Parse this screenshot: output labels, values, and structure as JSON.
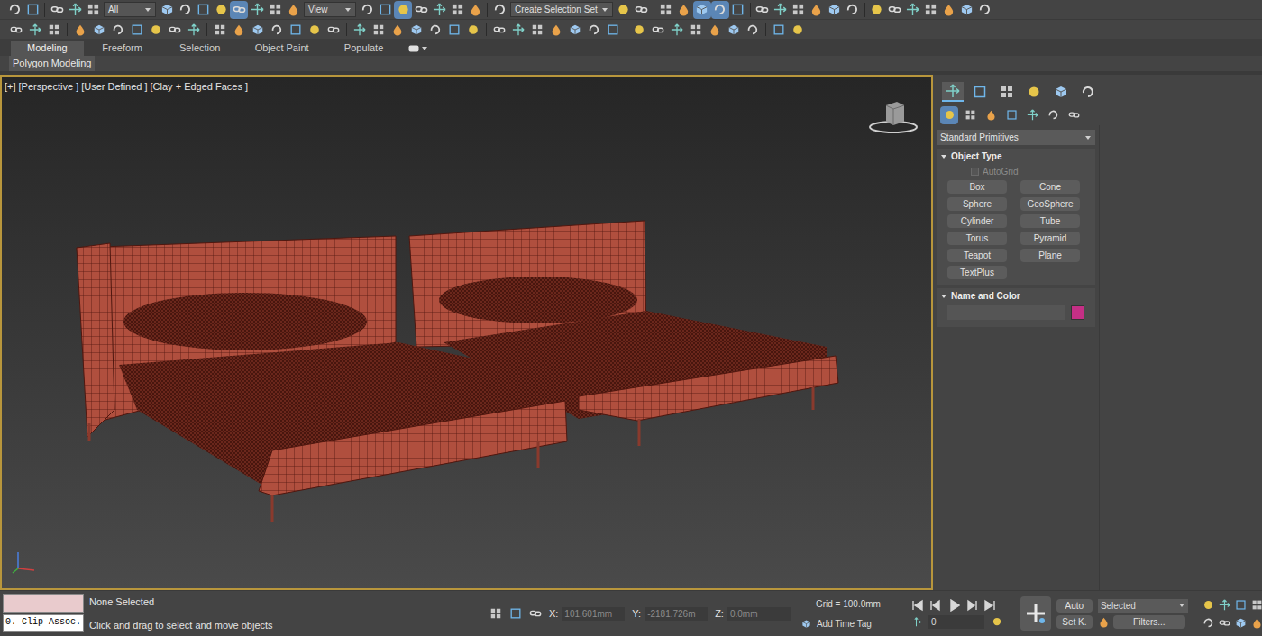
{
  "main_toolbar": {
    "items": [
      {
        "kind": "icon",
        "selected": false
      },
      {
        "kind": "icon",
        "selected": false
      },
      {
        "kind": "separator"
      },
      {
        "kind": "icon",
        "selected": false
      },
      {
        "kind": "icon",
        "selected": false
      },
      {
        "kind": "icon",
        "selected": false
      },
      {
        "kind": "dropdown",
        "text": "All"
      },
      {
        "kind": "icon",
        "selected": false
      },
      {
        "kind": "icon",
        "selected": false
      },
      {
        "kind": "icon",
        "selected": false
      },
      {
        "kind": "icon",
        "selected": false
      },
      {
        "kind": "icon",
        "selected": true
      },
      {
        "kind": "icon",
        "selected": false
      },
      {
        "kind": "icon",
        "selected": false
      },
      {
        "kind": "icon",
        "selected": false
      },
      {
        "kind": "dropdown",
        "text": "View"
      },
      {
        "kind": "icon",
        "selected": false
      },
      {
        "kind": "icon",
        "selected": false
      },
      {
        "kind": "icon",
        "selected": true
      },
      {
        "kind": "icon",
        "selected": false
      },
      {
        "kind": "icon",
        "selected": false
      },
      {
        "kind": "icon",
        "selected": false
      },
      {
        "kind": "icon",
        "selected": false
      },
      {
        "kind": "separator"
      },
      {
        "kind": "icon",
        "selected": false
      },
      {
        "kind": "dropdown",
        "text": "Create Selection Set"
      },
      {
        "kind": "icon",
        "selected": false
      },
      {
        "kind": "icon",
        "selected": false
      },
      {
        "kind": "separator"
      },
      {
        "kind": "icon",
        "selected": false
      },
      {
        "kind": "icon",
        "selected": false
      },
      {
        "kind": "icon",
        "selected": true
      },
      {
        "kind": "icon",
        "selected": true
      },
      {
        "kind": "icon",
        "selected": false
      },
      {
        "kind": "separator"
      },
      {
        "kind": "icon",
        "selected": false
      },
      {
        "kind": "icon",
        "selected": false
      },
      {
        "kind": "icon",
        "selected": false
      },
      {
        "kind": "icon",
        "selected": false
      },
      {
        "kind": "icon",
        "selected": false
      },
      {
        "kind": "icon",
        "selected": false
      },
      {
        "kind": "separator"
      },
      {
        "kind": "icon",
        "selected": false
      },
      {
        "kind": "icon",
        "selected": false
      },
      {
        "kind": "icon",
        "selected": false
      },
      {
        "kind": "icon",
        "selected": false
      },
      {
        "kind": "icon",
        "selected": false
      },
      {
        "kind": "icon",
        "selected": false
      },
      {
        "kind": "icon",
        "selected": false
      }
    ]
  },
  "ribbon": {
    "tabs": [
      {
        "label": "Modeling",
        "selected": true
      },
      {
        "label": "Freeform",
        "selected": false
      },
      {
        "label": "Selection",
        "selected": false
      },
      {
        "label": "Object Paint",
        "selected": false
      },
      {
        "label": "Populate",
        "selected": false
      }
    ],
    "panel": "Polygon Modeling"
  },
  "viewport": {
    "labels": [
      "[+]",
      "[Perspective ]",
      "[User Defined ]",
      "[Clay + Edged Faces ]"
    ],
    "active": true
  },
  "command_panel": {
    "tabs": [
      {
        "selected": true
      },
      {
        "selected": false
      },
      {
        "selected": false
      },
      {
        "selected": false
      },
      {
        "selected": false
      },
      {
        "selected": false
      }
    ],
    "subtabs": [
      {
        "selected": true
      },
      {
        "selected": false
      },
      {
        "selected": false
      },
      {
        "selected": false
      },
      {
        "selected": false
      },
      {
        "selected": false
      },
      {
        "selected": false
      }
    ],
    "category": "Standard Primitives",
    "rollouts": [
      {
        "title": "Object Type",
        "expanded": true,
        "autogrid": {
          "label": "AutoGrid",
          "checked": false,
          "disabled": true
        },
        "buttons": [
          "Box",
          "Cone",
          "Sphere",
          "GeoSphere",
          "Cylinder",
          "Tube",
          "Torus",
          "Pyramid",
          "Teapot",
          "Plane",
          "TextPlus"
        ]
      },
      {
        "title": "Name and Color",
        "expanded": true,
        "name_value": "",
        "swatch": "#c42f85"
      }
    ]
  },
  "status_bar": {
    "listener": {
      "top": "",
      "bottom": "0. Clip Assoc."
    },
    "selection": "None Selected",
    "prompt": "Click and drag to select and move objects",
    "coords": [
      {
        "axis": "X:",
        "value": "101.601mm",
        "disabled": true
      },
      {
        "axis": "Y:",
        "value": "-2181.726m",
        "disabled": true
      },
      {
        "axis": "Z:",
        "value": "0.0mm",
        "disabled": true
      }
    ],
    "grid": "Grid = 100.0mm",
    "time_tag": "Add Time Tag",
    "frame": "0",
    "auto": "Auto",
    "set_key": "Set K.",
    "key_filter": "Selected",
    "filters": "Filters..."
  }
}
